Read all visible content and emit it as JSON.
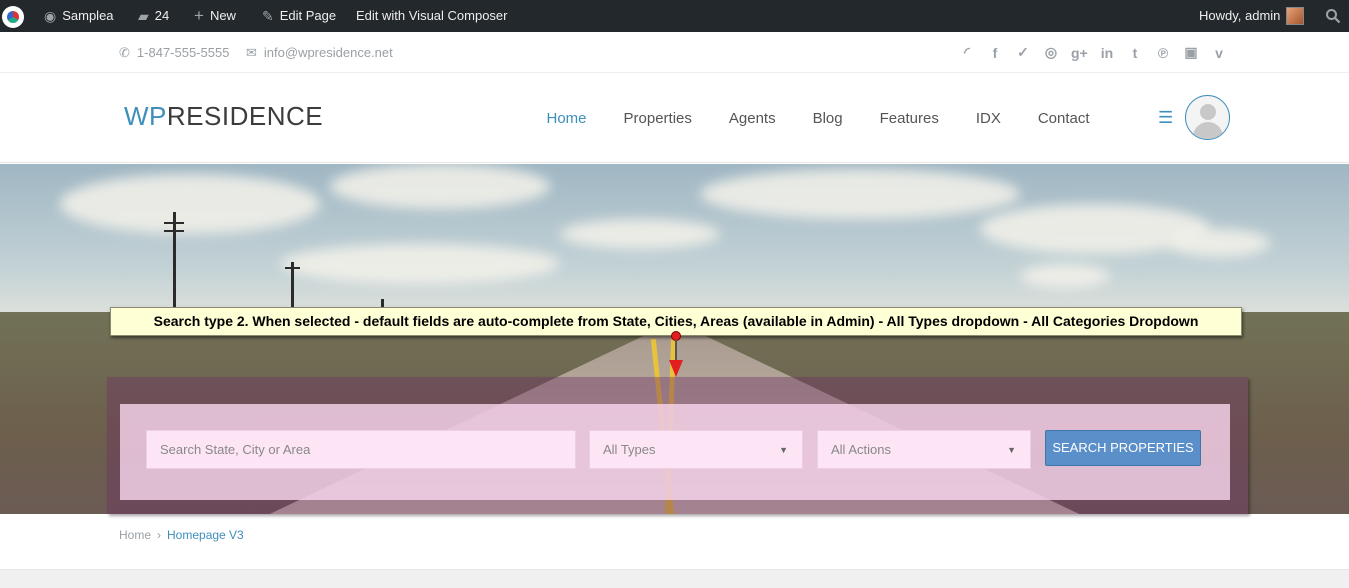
{
  "admin_bar": {
    "site_name": "Samplea",
    "comments_count": "24",
    "new_label": "New",
    "edit_page": "Edit Page",
    "visual_composer": "Edit with Visual Composer",
    "howdy": "Howdy, admin"
  },
  "top_bar": {
    "phone": "1-847-555-5555",
    "email": "info@wpresidence.net",
    "social_icons": [
      "rss-icon",
      "facebook-icon",
      "twitter-icon",
      "dribbble-icon",
      "google-plus-icon",
      "linkedin-icon",
      "tumblr-icon",
      "pinterest-icon",
      "youtube-icon",
      "vimeo-icon"
    ]
  },
  "header": {
    "logo_wp": "WP",
    "logo_rest": "RESIDENCE",
    "nav": [
      "Home",
      "Properties",
      "Agents",
      "Blog",
      "Features",
      "IDX",
      "Contact"
    ],
    "active_nav": "Home",
    "accent_color": "#3f8fbd"
  },
  "hero": {
    "annotation": "Search type 2. When selected - default fields are auto-complete from State, Cities, Areas (available in Admin) - All Types dropdown - All Categories Dropdown",
    "search": {
      "placeholder": "Search State, City or Area",
      "types_selected": "All Types",
      "actions_selected": "All Actions",
      "button_label": "SEARCH PROPERTIES"
    }
  },
  "breadcrumb": {
    "home": "Home",
    "separator": "›",
    "current": "Homepage V3"
  }
}
